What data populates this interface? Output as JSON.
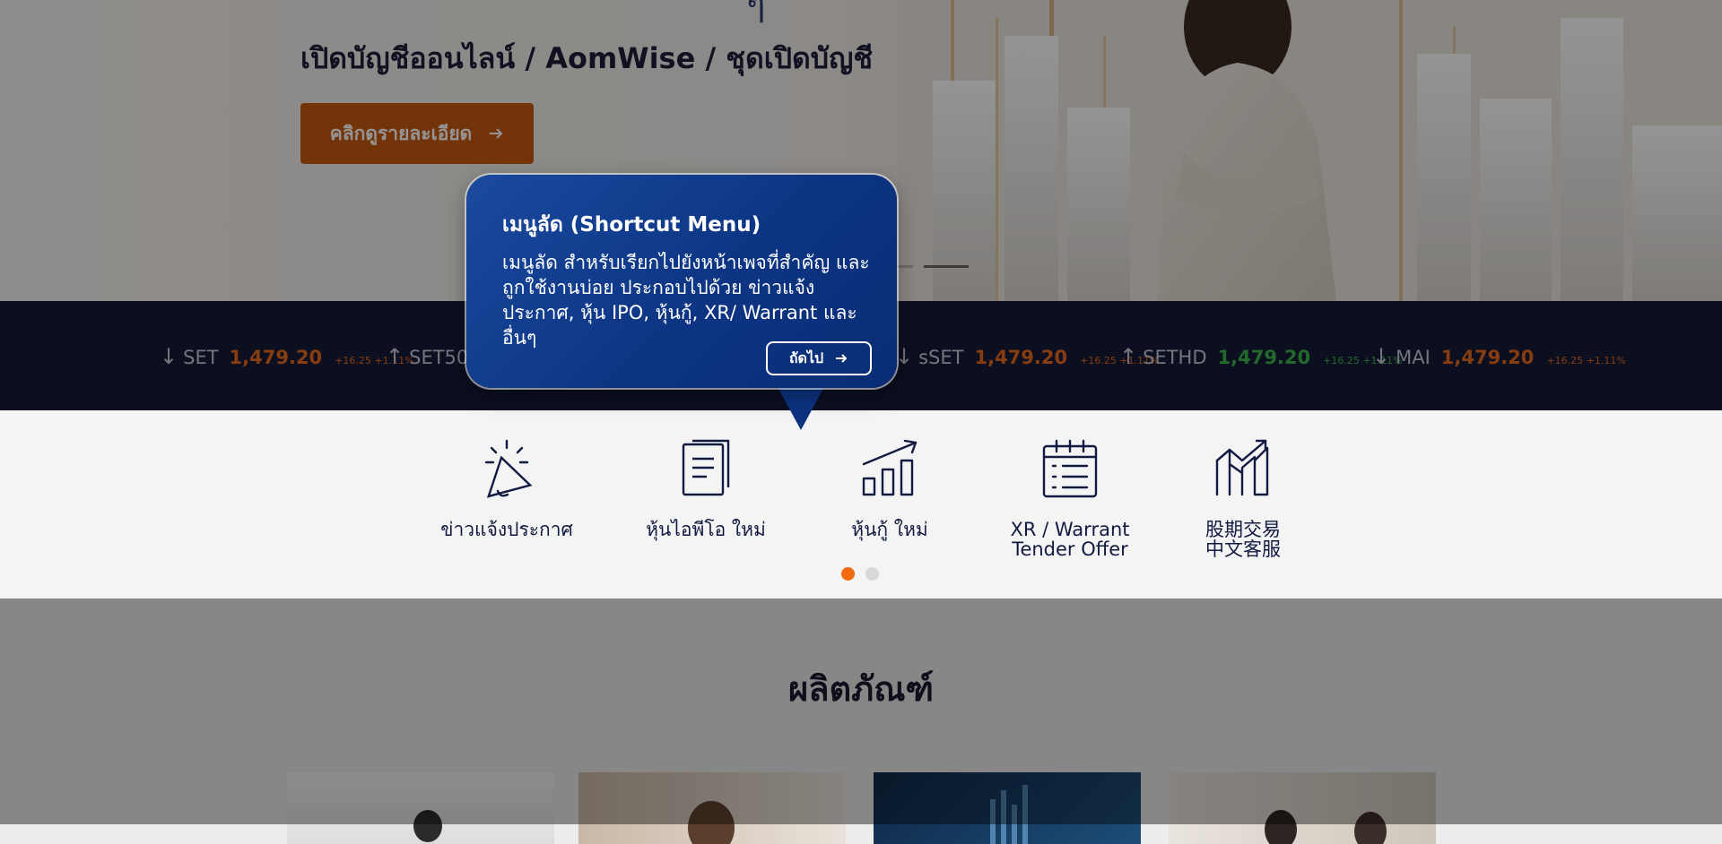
{
  "hero": {
    "title_tail": "ๆ",
    "subtitle": "เปิดบัญชีออนไลน์ / AomWise / ชุดเปิดบัญชี",
    "cta_label": "คลิกดูรายละเอียด",
    "cta_icon": "arrow-right-icon"
  },
  "ticker": [
    {
      "direction": "down",
      "arrow": "↓",
      "name": "SET",
      "value": "1,479.20",
      "change": "+16.25 +1.11%",
      "color": "#e86a1a"
    },
    {
      "direction": "up",
      "arrow": "↑",
      "name": "SET50",
      "value": "",
      "change": "",
      "color": "#e86a1a"
    },
    {
      "direction": "down",
      "arrow": "↓",
      "name": "sSET",
      "value": "1,479.20",
      "change": "+16.25 +1.11%",
      "color": "#e86a1a"
    },
    {
      "direction": "up",
      "arrow": "↑",
      "name": "SETHD",
      "value": "1,479.20",
      "change": "+16.25 +1.11%",
      "color": "#3bb54a"
    },
    {
      "direction": "down",
      "arrow": "↓",
      "name": "MAI",
      "value": "1,479.20",
      "change": "+16.25 +1.11%",
      "color": "#e86a1a"
    }
  ],
  "shortcuts": [
    {
      "label": "ข่าวแจ้งประกาศ",
      "icon": "megaphone-icon"
    },
    {
      "label": "หุ้นไอพีโอ ใหม่",
      "icon": "document-icon"
    },
    {
      "label": "หุ้นกู้ ใหม่",
      "icon": "bar-chart-icon"
    },
    {
      "label": "XR / Warrant\nTender Offer",
      "icon": "calendar-list-icon"
    },
    {
      "label": "股期交易\n中文客服",
      "icon": "trend-chart-icon"
    }
  ],
  "pager": {
    "active": 1,
    "total": 2
  },
  "products": {
    "title": "ผลิตภัณฑ์"
  },
  "tooltip": {
    "title": "เมนูลัด (Shortcut Menu)",
    "body": "เมนูลัด สำหรับเรียกไปยังหน้าเพจที่สำคัญ และถูกใช้งานบ่อย ประกอบไปด้วย ข่าวแจ้งประกาศ, หุ้น IPO, หุ้นกู้, XR/ Warrant และ อื่นๆ",
    "next_label": "ถัดไป"
  },
  "colors": {
    "accent": "#f26b10",
    "navy": "#131a38",
    "tooltip_blue": "#0d3584",
    "up": "#3bb54a",
    "down": "#e86a1a"
  }
}
